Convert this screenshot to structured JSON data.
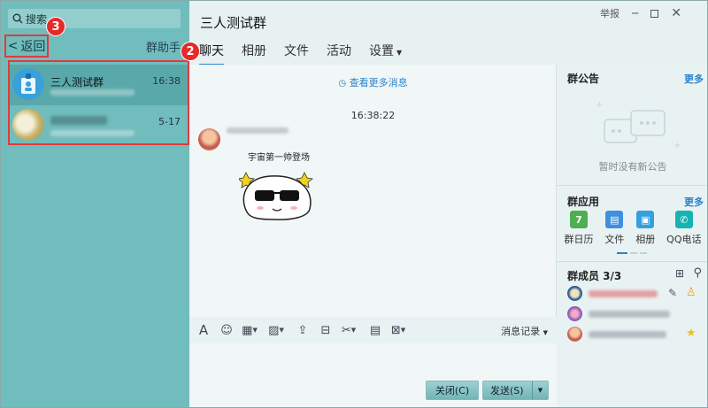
{
  "left": {
    "search_label": "搜索",
    "back_label": "返回",
    "helper_label": "群助手",
    "badge_back": "3",
    "chats": [
      {
        "name": "三人测试群",
        "time": "16:38",
        "selected": true
      },
      {
        "name": "",
        "time": "5-17",
        "selected": false
      }
    ]
  },
  "header": {
    "title": "三人测试群",
    "tabs": [
      "聊天",
      "相册",
      "文件",
      "活动",
      "设置"
    ],
    "active_tab": "聊天",
    "badge_tabs": "2",
    "window_controls": {
      "report": "举报"
    }
  },
  "chat": {
    "more_messages": "查看更多消息",
    "timestamp": "16:38:22",
    "sticker_caption": "宇宙第一帅登场"
  },
  "toolbar": {
    "icons": [
      "font-icon",
      "emoji-icon",
      "gift-icon",
      "image-icon",
      "upload-icon",
      "redpacket-icon",
      "scissors-icon",
      "folder-icon",
      "screenshot-icon"
    ],
    "history_label": "消息记录"
  },
  "buttons": {
    "close": "关闭(C)",
    "send": "发送(S)"
  },
  "sidebar": {
    "notice_title": "群公告",
    "notice_more": "更多",
    "notice_empty": "暂时没有新公告",
    "apps_title": "群应用",
    "apps_more": "更多",
    "apps": [
      {
        "label": "群日历",
        "icon": "calendar-icon",
        "color": "#4caf50",
        "glyph": "7"
      },
      {
        "label": "文件",
        "icon": "folder-icon",
        "color": "#3d8fe0",
        "glyph": "▤"
      },
      {
        "label": "相册",
        "icon": "photo-icon",
        "color": "#33a1e0",
        "glyph": "▣"
      },
      {
        "label": "QQ电话",
        "icon": "phone-icon",
        "color": "#17b3b0",
        "glyph": "✆"
      }
    ],
    "members_title": "群成员 3/3"
  },
  "colors": {
    "left_panel": "#71bcbd",
    "selected_row": "#5aa9aa",
    "highlight": "#e23a3a",
    "link": "#2a83c9"
  }
}
